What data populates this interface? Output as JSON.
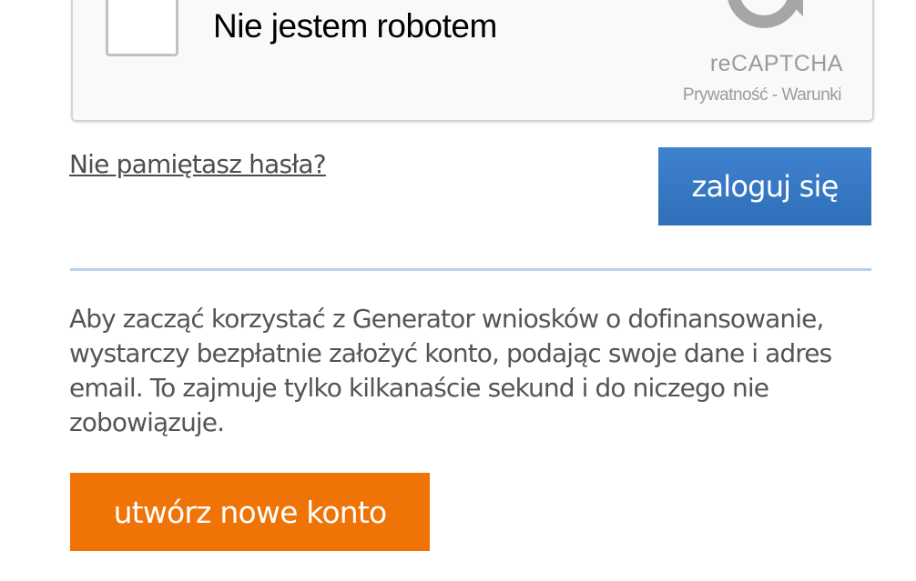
{
  "recaptcha": {
    "label": "Nie jestem robotem",
    "brand": "reCAPTCHA",
    "privacy_link": "Prywatność",
    "separator": " - ",
    "terms_link": "Warunki",
    "logo_icon": "recaptcha-logo-icon"
  },
  "login": {
    "forgot_password_link": "Nie pamiętasz hasła?",
    "login_button": "zaloguj się"
  },
  "register": {
    "info_text": "Aby zacząć korzystać z Generator wniosków o dofinansowanie, wystarczy bezpłatnie założyć konto, podając swoje dane i adres email. To zajmuje tylko kilkanaście sekund i do niczego nie zobowiązuje.",
    "create_account_button": "utwórz nowe konto"
  },
  "colors": {
    "login_button": "#3572c0",
    "create_button": "#f07306",
    "divider": "#b8d1e8",
    "text": "#555555"
  }
}
